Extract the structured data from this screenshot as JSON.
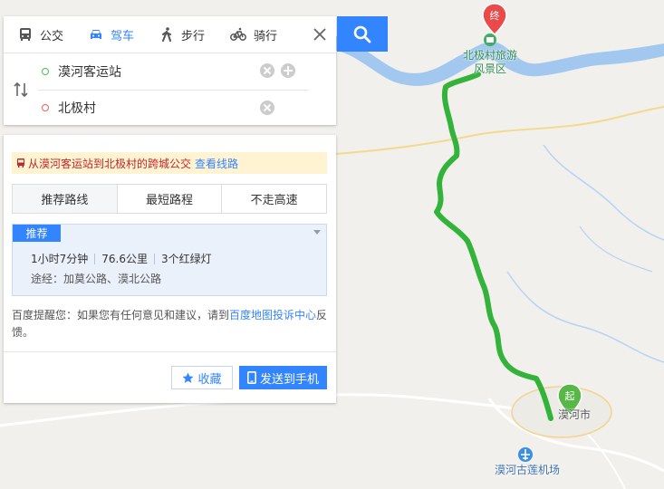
{
  "modes": [
    {
      "label": "公交",
      "icon": "bus-icon",
      "active": false
    },
    {
      "label": "驾车",
      "icon": "car-icon",
      "active": true
    },
    {
      "label": "步行",
      "icon": "walk-icon",
      "active": false
    },
    {
      "label": "骑行",
      "icon": "bike-icon",
      "active": false
    }
  ],
  "route": {
    "start": "漠河客运站",
    "end": "北极村"
  },
  "notice": {
    "text": "从漠河客运站到北极村的跨城公交",
    "link": "查看线路"
  },
  "strategies": [
    "推荐路线",
    "最短路程",
    "不走高速"
  ],
  "result": {
    "badge": "推荐",
    "duration": "1小时7分钟",
    "distance": "76.6公里",
    "lights": "3个红绿灯",
    "via": "途经：加莫公路、漠北公路"
  },
  "hint": {
    "prefix": "百度提醒您：如果您有任何意见和建议，请到",
    "link": "百度地图投诉中心",
    "suffix": "反馈。"
  },
  "actions": {
    "favorite": "收藏",
    "send": "发送到手机"
  },
  "map": {
    "end_marker": "终",
    "start_marker": "起",
    "poi_beiji_line1": "北极村旅游",
    "poi_beiji_line2": "风景区",
    "city": "漠河市",
    "airport": "漠河古莲机场"
  },
  "colors": {
    "accent": "#3385ff",
    "route": "#33b33a",
    "end_marker": "#e94b4b",
    "start_marker": "#57b847"
  }
}
